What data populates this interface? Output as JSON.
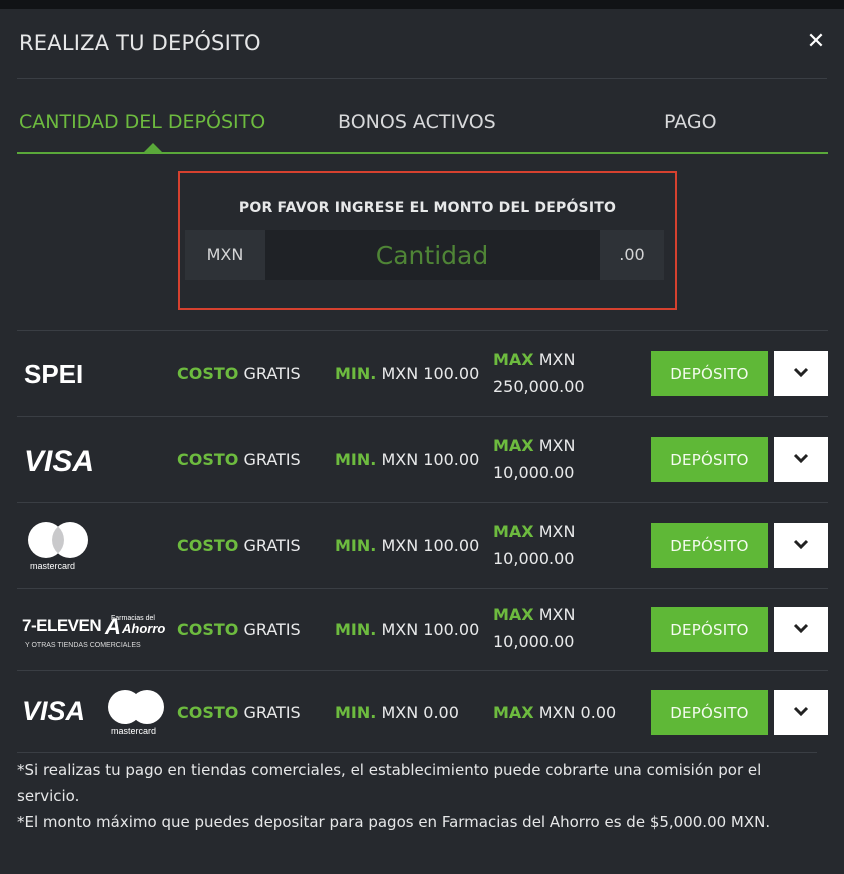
{
  "modal": {
    "title": "REALIZA TU DEPÓSITO",
    "close_symbol": "✕"
  },
  "tabs": [
    {
      "label": "CANTIDAD DEL DEPÓSITO",
      "active": true
    },
    {
      "label": "BONOS ACTIVOS",
      "active": false
    },
    {
      "label": "PAGO",
      "active": false
    }
  ],
  "amount": {
    "label": "POR FAVOR INGRESE EL MONTO DEL DEPÓSITO",
    "currency": "MXN",
    "placeholder": "Cantidad",
    "decimals": ".00"
  },
  "methods": [
    {
      "logo": "spei-logo",
      "logo_text": "SPEI",
      "cost_label": "COSTO",
      "cost_value": "GRATIS",
      "min_label": "MIN.",
      "min_value": "MXN 100.00",
      "max_label": "MAX",
      "max_value_line1": "MXN",
      "max_value_line2": "250,000.00",
      "button": "DEPÓSITO"
    },
    {
      "logo": "visa-logo",
      "logo_text": "VISA",
      "cost_label": "COSTO",
      "cost_value": "GRATIS",
      "min_label": "MIN.",
      "min_value": "MXN 100.00",
      "max_label": "MAX",
      "max_value_line1": "MXN",
      "max_value_line2": "10,000.00",
      "button": "DEPÓSITO"
    },
    {
      "logo": "mastercard-logo",
      "logo_text": "mastercard",
      "cost_label": "COSTO",
      "cost_value": "GRATIS",
      "min_label": "MIN.",
      "min_value": "MXN 100.00",
      "max_label": "MAX",
      "max_value_line1": "MXN",
      "max_value_line2": "10,000.00",
      "button": "DEPÓSITO"
    },
    {
      "logo": "seven-eleven-ahorro-logo",
      "logo_text": "7-ELEVEN",
      "logo_text_2": "Y OTRAS TIENDAS COMERCIALES",
      "logo_text_3": "Ahorro",
      "logo_text_4": "Farmacias del",
      "cost_label": "COSTO",
      "cost_value": "GRATIS",
      "min_label": "MIN.",
      "min_value": "MXN 100.00",
      "max_label": "MAX",
      "max_value_line1": "MXN",
      "max_value_line2": "10,000.00",
      "button": "DEPÓSITO"
    },
    {
      "logo": "visa-mastercard-logo",
      "logo_text": "VISA",
      "logo_text_2": "mastercard",
      "cost_label": "COSTO",
      "cost_value": "GRATIS",
      "min_label": "MIN.",
      "min_value": "MXN 0.00",
      "max_label": "MAX",
      "max_value_line1": "MXN 0.00",
      "max_value_line2": "",
      "button": "DEPÓSITO"
    }
  ],
  "notes": [
    "*Si realizas tu pago en tiendas comerciales, el establecimiento puede cobrarte una comisión por el servicio.",
    "*El monto máximo que puedes depositar para pagos en Farmacias del Ahorro es de $5,000.00 MXN."
  ],
  "colors": {
    "accent_green": "#6dbb3f",
    "button_green": "#5fb837",
    "highlight_red": "#d6412f",
    "modal_bg": "#26292e"
  }
}
